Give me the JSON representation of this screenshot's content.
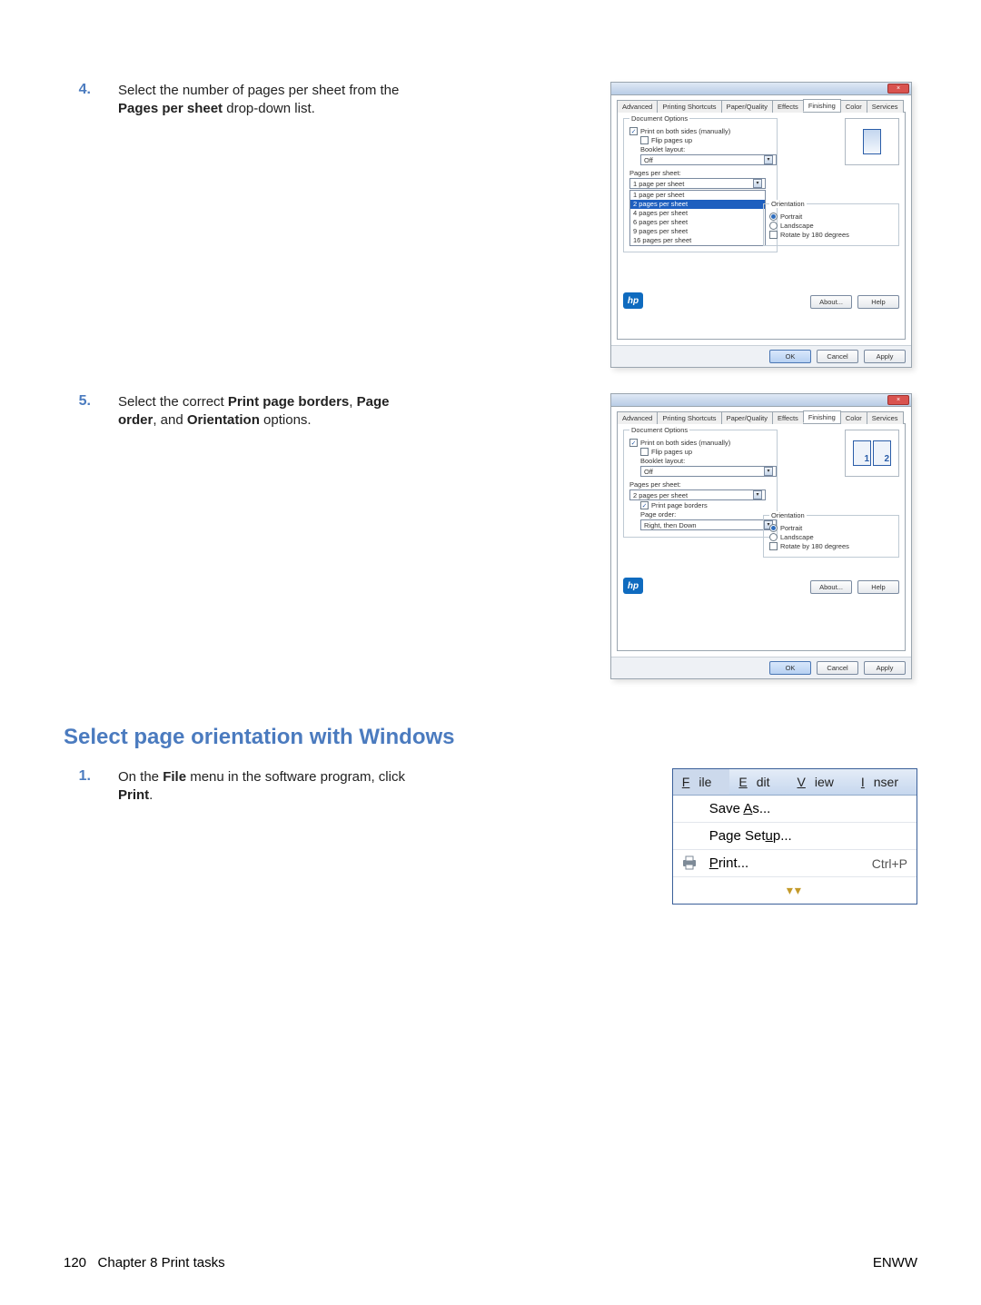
{
  "steps": {
    "s4": {
      "num": "4.",
      "text_a": "Select the number of pages per sheet from the ",
      "bold_a": "Pages per sheet",
      "text_b": " drop-down list."
    },
    "s5": {
      "num": "5.",
      "text_a": "Select the correct ",
      "bold_a": "Print page borders",
      "text_b": ", ",
      "bold_b": "Page order",
      "text_c": ", and ",
      "bold_c": "Orientation",
      "text_d": " options."
    },
    "s1": {
      "num": "1.",
      "text_a": "On the ",
      "bold_a": "File",
      "text_b": " menu in the software program, click ",
      "bold_b": "Print",
      "text_c": "."
    }
  },
  "dlg": {
    "tabs": [
      "Advanced",
      "Printing Shortcuts",
      "Paper/Quality",
      "Effects",
      "Finishing",
      "Color",
      "Services"
    ],
    "docopt_label": "Document Options",
    "both_sides": "Print on both sides (manually)",
    "flip": "Flip pages up",
    "booklet": "Booklet layout:",
    "booklet_val": "Off",
    "pps_label": "Pages per sheet:",
    "pps_sel": "1 page per sheet",
    "pps_opts": [
      "1 page per sheet",
      "2 pages per sheet",
      "4 pages per sheet",
      "6 pages per sheet",
      "9 pages per sheet",
      "16 pages per sheet"
    ],
    "pps_sel2": "2 pages per sheet",
    "print_borders": "Print page borders",
    "page_order": "Page order:",
    "page_order_val": "Right, then Down",
    "orient_label": "Orientation",
    "portrait": "Portrait",
    "landscape": "Landscape",
    "rotate": "Rotate by 180 degrees",
    "about": "About...",
    "help": "Help",
    "ok": "OK",
    "cancel": "Cancel",
    "apply": "Apply"
  },
  "section_head": "Select page orientation with Windows",
  "menu": {
    "file": "File",
    "edit": "Edit",
    "view": "View",
    "insert": "Inser",
    "saveas": "Save As...",
    "pagesetup": "Page Setup...",
    "print": "Print...",
    "print_sc": "Ctrl+P"
  },
  "footer": {
    "page": "120",
    "chapter": "Chapter 8   Print tasks",
    "right": "ENWW"
  }
}
